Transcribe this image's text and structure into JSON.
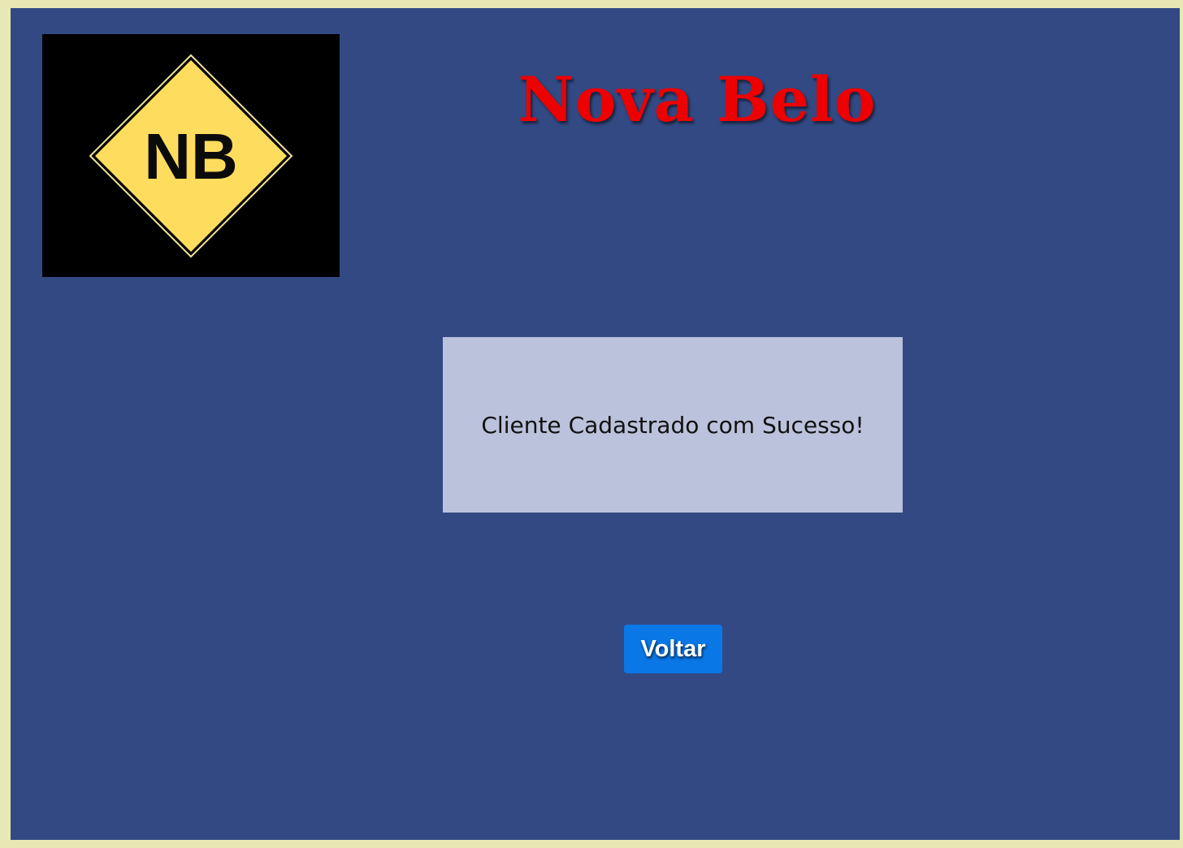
{
  "header": {
    "logo_text": "NB",
    "title": "Nova Belo"
  },
  "message": {
    "text": "Cliente Cadastrado com Sucesso!"
  },
  "actions": {
    "back_label": "Voltar"
  },
  "colors": {
    "page_border": "#e8e8b4",
    "background": "#324983",
    "title": "#ee0000",
    "message_box": "#bbc2db",
    "button": "#0a77e6",
    "logo_diamond": "#fedd5e"
  }
}
